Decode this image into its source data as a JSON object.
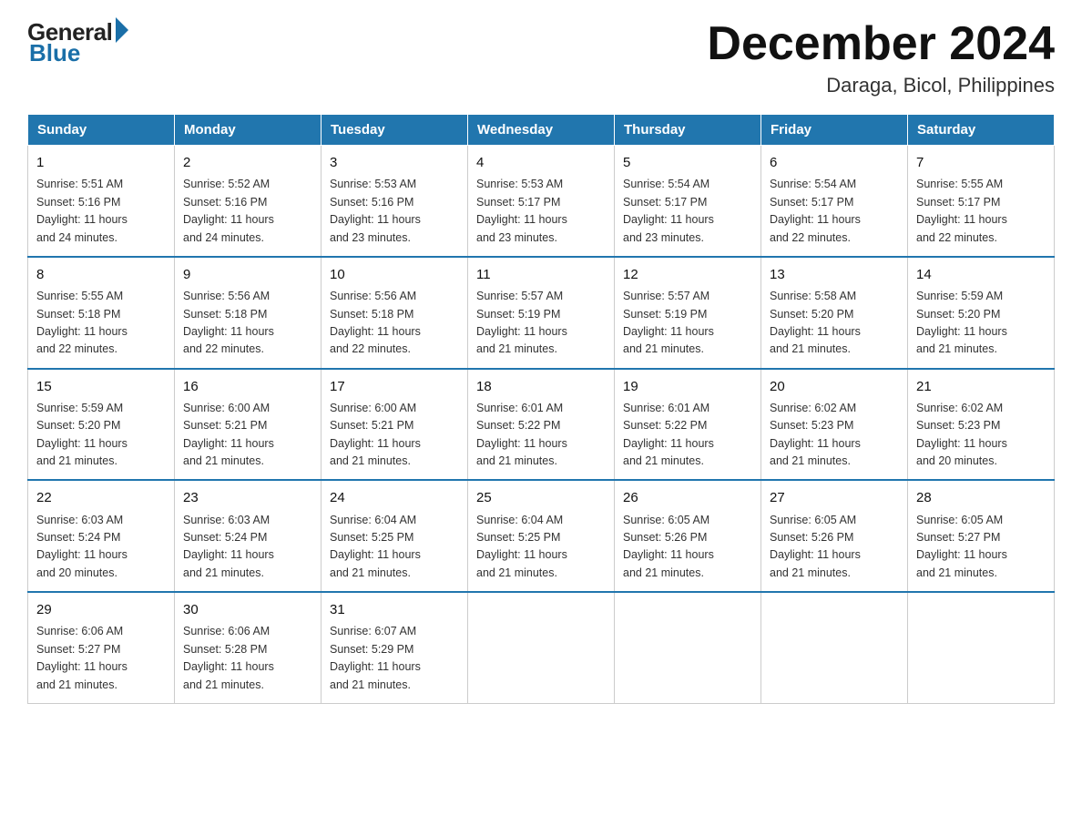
{
  "logo": {
    "general": "General",
    "blue": "Blue"
  },
  "header": {
    "month": "December 2024",
    "location": "Daraga, Bicol, Philippines"
  },
  "weekdays": [
    "Sunday",
    "Monday",
    "Tuesday",
    "Wednesday",
    "Thursday",
    "Friday",
    "Saturday"
  ],
  "weeks": [
    [
      {
        "day": "1",
        "sunrise": "5:51 AM",
        "sunset": "5:16 PM",
        "daylight": "11 hours and 24 minutes."
      },
      {
        "day": "2",
        "sunrise": "5:52 AM",
        "sunset": "5:16 PM",
        "daylight": "11 hours and 24 minutes."
      },
      {
        "day": "3",
        "sunrise": "5:53 AM",
        "sunset": "5:16 PM",
        "daylight": "11 hours and 23 minutes."
      },
      {
        "day": "4",
        "sunrise": "5:53 AM",
        "sunset": "5:17 PM",
        "daylight": "11 hours and 23 minutes."
      },
      {
        "day": "5",
        "sunrise": "5:54 AM",
        "sunset": "5:17 PM",
        "daylight": "11 hours and 23 minutes."
      },
      {
        "day": "6",
        "sunrise": "5:54 AM",
        "sunset": "5:17 PM",
        "daylight": "11 hours and 22 minutes."
      },
      {
        "day": "7",
        "sunrise": "5:55 AM",
        "sunset": "5:17 PM",
        "daylight": "11 hours and 22 minutes."
      }
    ],
    [
      {
        "day": "8",
        "sunrise": "5:55 AM",
        "sunset": "5:18 PM",
        "daylight": "11 hours and 22 minutes."
      },
      {
        "day": "9",
        "sunrise": "5:56 AM",
        "sunset": "5:18 PM",
        "daylight": "11 hours and 22 minutes."
      },
      {
        "day": "10",
        "sunrise": "5:56 AM",
        "sunset": "5:18 PM",
        "daylight": "11 hours and 22 minutes."
      },
      {
        "day": "11",
        "sunrise": "5:57 AM",
        "sunset": "5:19 PM",
        "daylight": "11 hours and 21 minutes."
      },
      {
        "day": "12",
        "sunrise": "5:57 AM",
        "sunset": "5:19 PM",
        "daylight": "11 hours and 21 minutes."
      },
      {
        "day": "13",
        "sunrise": "5:58 AM",
        "sunset": "5:20 PM",
        "daylight": "11 hours and 21 minutes."
      },
      {
        "day": "14",
        "sunrise": "5:59 AM",
        "sunset": "5:20 PM",
        "daylight": "11 hours and 21 minutes."
      }
    ],
    [
      {
        "day": "15",
        "sunrise": "5:59 AM",
        "sunset": "5:20 PM",
        "daylight": "11 hours and 21 minutes."
      },
      {
        "day": "16",
        "sunrise": "6:00 AM",
        "sunset": "5:21 PM",
        "daylight": "11 hours and 21 minutes."
      },
      {
        "day": "17",
        "sunrise": "6:00 AM",
        "sunset": "5:21 PM",
        "daylight": "11 hours and 21 minutes."
      },
      {
        "day": "18",
        "sunrise": "6:01 AM",
        "sunset": "5:22 PM",
        "daylight": "11 hours and 21 minutes."
      },
      {
        "day": "19",
        "sunrise": "6:01 AM",
        "sunset": "5:22 PM",
        "daylight": "11 hours and 21 minutes."
      },
      {
        "day": "20",
        "sunrise": "6:02 AM",
        "sunset": "5:23 PM",
        "daylight": "11 hours and 21 minutes."
      },
      {
        "day": "21",
        "sunrise": "6:02 AM",
        "sunset": "5:23 PM",
        "daylight": "11 hours and 20 minutes."
      }
    ],
    [
      {
        "day": "22",
        "sunrise": "6:03 AM",
        "sunset": "5:24 PM",
        "daylight": "11 hours and 20 minutes."
      },
      {
        "day": "23",
        "sunrise": "6:03 AM",
        "sunset": "5:24 PM",
        "daylight": "11 hours and 21 minutes."
      },
      {
        "day": "24",
        "sunrise": "6:04 AM",
        "sunset": "5:25 PM",
        "daylight": "11 hours and 21 minutes."
      },
      {
        "day": "25",
        "sunrise": "6:04 AM",
        "sunset": "5:25 PM",
        "daylight": "11 hours and 21 minutes."
      },
      {
        "day": "26",
        "sunrise": "6:05 AM",
        "sunset": "5:26 PM",
        "daylight": "11 hours and 21 minutes."
      },
      {
        "day": "27",
        "sunrise": "6:05 AM",
        "sunset": "5:26 PM",
        "daylight": "11 hours and 21 minutes."
      },
      {
        "day": "28",
        "sunrise": "6:05 AM",
        "sunset": "5:27 PM",
        "daylight": "11 hours and 21 minutes."
      }
    ],
    [
      {
        "day": "29",
        "sunrise": "6:06 AM",
        "sunset": "5:27 PM",
        "daylight": "11 hours and 21 minutes."
      },
      {
        "day": "30",
        "sunrise": "6:06 AM",
        "sunset": "5:28 PM",
        "daylight": "11 hours and 21 minutes."
      },
      {
        "day": "31",
        "sunrise": "6:07 AM",
        "sunset": "5:29 PM",
        "daylight": "11 hours and 21 minutes."
      },
      null,
      null,
      null,
      null
    ]
  ],
  "labels": {
    "sunrise": "Sunrise:",
    "sunset": "Sunset:",
    "daylight": "Daylight:"
  }
}
